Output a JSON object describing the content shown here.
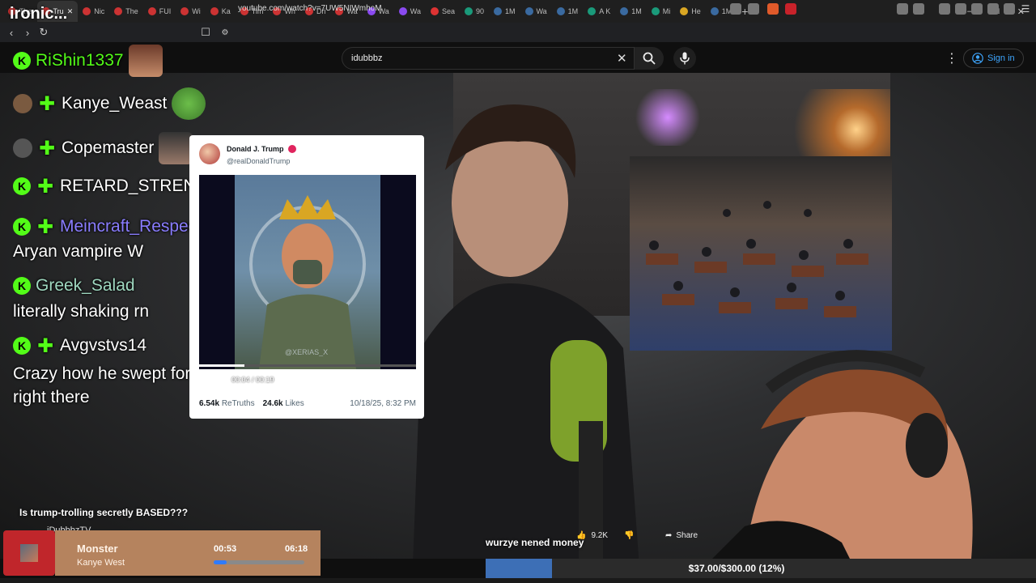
{
  "overlay_title": "ironic...",
  "browser": {
    "tabs": [
      "The",
      "Tru",
      "Nic",
      "The",
      "FUI",
      "Wi",
      "Ka",
      "Tim",
      "Wh",
      "Dri",
      "Wa",
      "Wa",
      "Wa",
      "Sea",
      "90",
      "1M",
      "Wa",
      "1M",
      "A K",
      "1M",
      "Mi",
      "He",
      "1M"
    ],
    "active_tab_index": 1,
    "url": "youtube.com/watch?v=7UW5NIWmhoM"
  },
  "youtube": {
    "search_query": "idubbbz",
    "sign_in_label": "Sign in",
    "video_title": "Is trump-trolling secretly BASED???",
    "channel_name": "iDubbbzTV",
    "like_count": "9.2K",
    "share_label": "Share",
    "caption": "wurzye nened money"
  },
  "chat": [
    {
      "user": "RiShin1337",
      "message": ""
    },
    {
      "user": "Kanye_Weast",
      "message": ""
    },
    {
      "user": "Copemaster",
      "message": ""
    },
    {
      "user": "RETARD_STRENGTH",
      "message": ""
    },
    {
      "user": "Meincraft_Respector",
      "message": "Aryan vampire W"
    },
    {
      "user": "Greek_Salad",
      "message": "literally shaking rn"
    },
    {
      "user": "Avgvstvs14",
      "message": "Crazy how he swept for Hasan right there"
    }
  ],
  "chat_name_colors": {
    "RiShin1337": "#53fc18",
    "Greek_Salad": "#9fd8c0",
    "Meincraft_Respector": "#8a7dff"
  },
  "tweet": {
    "name": "Donald J. Trump",
    "handle": "@realDonaldTrump",
    "video_time": "00:04 / 00:19",
    "video_progress": 0.21,
    "retruths": "6.54k",
    "retruths_label": "ReTruths",
    "likes": "24.6k",
    "likes_label": "Likes",
    "date": "10/18/25, 8:32 PM",
    "watermark": "@XERIAS_X"
  },
  "now_playing": {
    "song": "Monster",
    "artist": "Kanye West",
    "elapsed": "00:53",
    "total": "06:18",
    "progress": 0.14
  },
  "donation": {
    "text": "$37.00/$300.00 (12%)",
    "progress": 0.12
  },
  "colors": {
    "kick_green": "#53fc18",
    "yt_blue": "#3ea6ff",
    "widget_tan": "#b5835e",
    "widget_red": "#c0262b",
    "donation_blue": "#3d6fb6"
  }
}
